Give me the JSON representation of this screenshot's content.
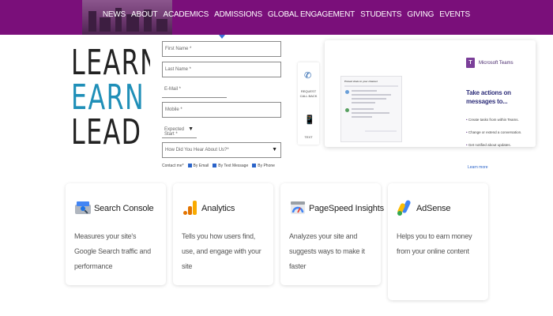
{
  "header": {
    "nav": [
      "NEWS",
      "ABOUT",
      "ACADEMICS",
      "ADMISSIONS",
      "GLOBAL ENGAGEMENT",
      "STUDENTS",
      "GIVING",
      "EVENTS"
    ],
    "brand_color": "#7a0f7a"
  },
  "slogan": {
    "line1": "LEARN",
    "line2": "EARN",
    "line3": "LEAD"
  },
  "form": {
    "first_name": "First Name *",
    "last_name": "Last Name *",
    "email": "E-Mail *",
    "mobile": "Mobile *",
    "expected_start": "Expected Start *",
    "how_heard": "How Did You Hear About Us?*",
    "contact_label": "Contact me*",
    "by_email": "By Email",
    "by_text": "By Text Message",
    "by_phone": "By Phone"
  },
  "contact_widget": {
    "call_line1": "REQUEST",
    "call_line2": "CALL BACK",
    "chat_label": "TEXT",
    "call_icon": "phone-icon",
    "chat_icon": "chat-icon"
  },
  "teams_promo": {
    "brand": "Microsoft Teams",
    "headline": "Take actions on messages to...",
    "bullets": [
      "Create tasks from within Teams.",
      "Change or extend a conversation.",
      "Get notified about updates."
    ],
    "link": "Learn more",
    "mock_header": "Pinned chats in your channel"
  },
  "tools": [
    {
      "title": "Search Console",
      "desc": "Measures your site's Google Search traffic and performance",
      "icon": "search-console-icon"
    },
    {
      "title": "Analytics",
      "desc": "Tells you how users find, use, and engage with your site",
      "icon": "analytics-icon"
    },
    {
      "title": "PageSpeed Insights",
      "desc": "Analyzes your site and suggests ways to make it faster",
      "icon": "pagespeed-icon"
    },
    {
      "title": "AdSense",
      "desc": "Helps you to earn money from your online content",
      "icon": "adsense-icon"
    }
  ]
}
